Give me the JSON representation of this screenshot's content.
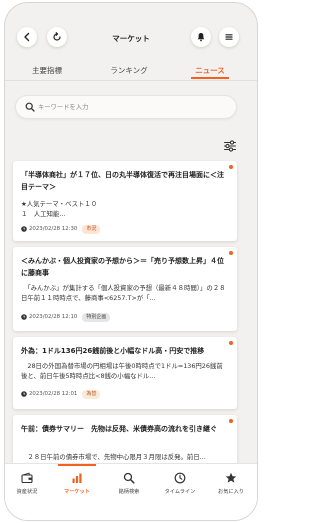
{
  "header": {
    "title": "マーケット"
  },
  "tabs": [
    {
      "label": "主要指標",
      "active": false
    },
    {
      "label": "ランキング",
      "active": false
    },
    {
      "label": "ニュース",
      "active": true
    }
  ],
  "search": {
    "placeholder": "キーワードを入力",
    "value": ""
  },
  "news": [
    {
      "title": "「半導体商社」が１７位、日の丸半導体復活で再注目場面に＜注目テーマ＞",
      "body": "★人気テーマ・ベスト１０\n１　人工知能...",
      "time": "2023/02/28 12:30",
      "tag": "市況",
      "unread": true
    },
    {
      "title": "＜みんかぶ・個人投資家の予想から＞＝「売り予想数上昇」４位に藤商事",
      "body": "　「みんかぶ」が集計する「個人投資家の予想（最新４８時間）」の２８日午前１１時時点で、藤商事<6257.T>が「...",
      "time": "2023/02/28 12:10",
      "tag": "特別企画",
      "unread": true
    },
    {
      "title": "外為：1ドル136円26銭前後と小幅なドル高・円安で推移",
      "body": "　28日の外国為替市場の円相場は午後0時時点で1ドル=136円26銭前後と、前日午後5時時点比<8銭の小幅なドル...",
      "time": "2023/02/28 12:01",
      "tag": "為替",
      "unread": true
    },
    {
      "title": "午前：債券サマリー　先物は反発、米債券高の流れを引き継ぐ",
      "body": "　２８日午前の債券市場で、先物中心限月３月限は反発。前日...",
      "time": "",
      "tag": "",
      "unread": true
    }
  ],
  "bottom_nav": [
    {
      "label": "資産状況",
      "icon": "wallet-icon",
      "active": false
    },
    {
      "label": "マーケット",
      "icon": "bar-chart-icon",
      "active": true
    },
    {
      "label": "銘柄検索",
      "icon": "search-icon",
      "active": false
    },
    {
      "label": "タイムライン",
      "icon": "clock-icon",
      "active": false
    },
    {
      "label": "お気に入り",
      "icon": "star-icon",
      "active": false
    }
  ],
  "colors": {
    "accent": "#f0621e",
    "background": "#f3f1ef"
  }
}
